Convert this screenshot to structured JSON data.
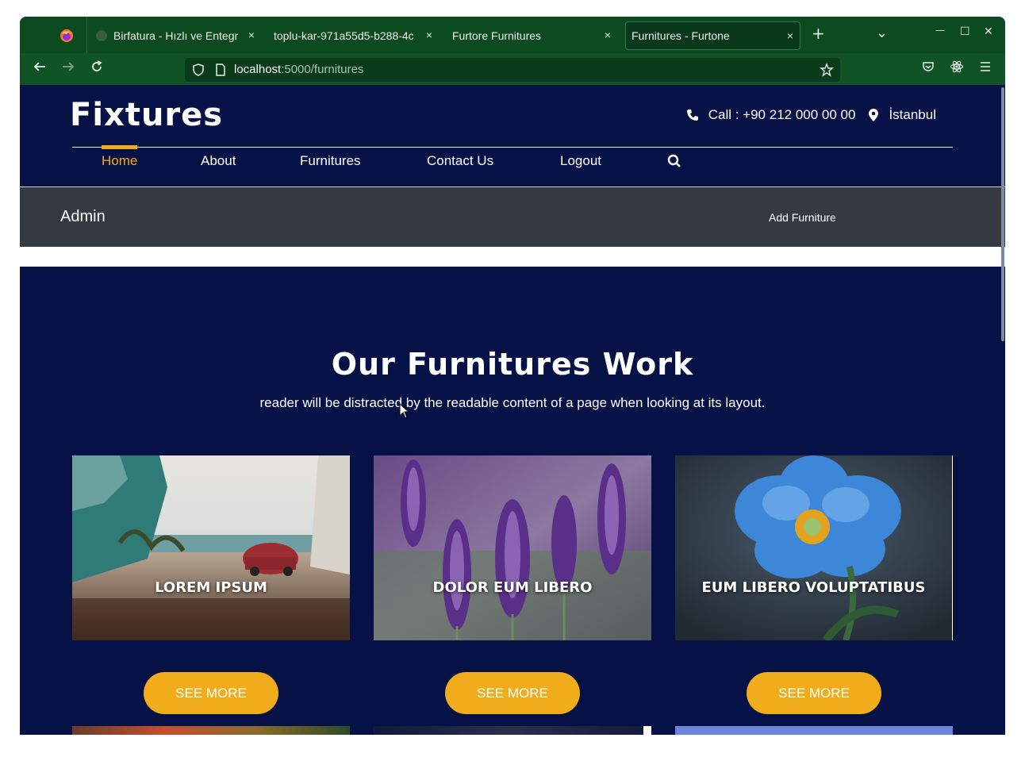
{
  "browser": {
    "tabs": [
      {
        "title": "Birfatura - Hızlı ve Entegr",
        "close": "×"
      },
      {
        "title": "toplu-kar-971a55d5-b288-4c",
        "close": "×"
      },
      {
        "title": "Furtore Furnitures",
        "close": "×"
      },
      {
        "title": "Furnitures - Furtone",
        "close": "×"
      }
    ],
    "new_tab": "+",
    "tab_list": "⌄",
    "minimize": "—",
    "maximize": "☐",
    "close": "✕",
    "url_host": "localhost",
    "url_path": ":5000/furnitures",
    "accent": "#0f5327"
  },
  "site": {
    "brand": "Fixtures",
    "phone": "Call : +90 212 000 00 00",
    "location": "İstanbul",
    "menu": [
      "Home",
      "About",
      "Furnitures",
      "Contact Us",
      "Logout"
    ],
    "admin_title": "Admin",
    "add_link": "Add Furniture",
    "section_title": "Our Furnitures Work",
    "section_sub": "reader will be distracted by the readable content of a page when looking at its layout.",
    "cards": [
      {
        "label": "LOREM IPSUM",
        "button": "SEE MORE"
      },
      {
        "label": "DOLOR EUM LIBERO",
        "button": "SEE MORE"
      },
      {
        "label": "EUM LIBERO VOLUPTATIBUS",
        "button": "SEE MORE"
      }
    ],
    "colors": {
      "background": "#061246",
      "accent": "#f0ac1b",
      "admin_bar": "#343a40"
    }
  }
}
